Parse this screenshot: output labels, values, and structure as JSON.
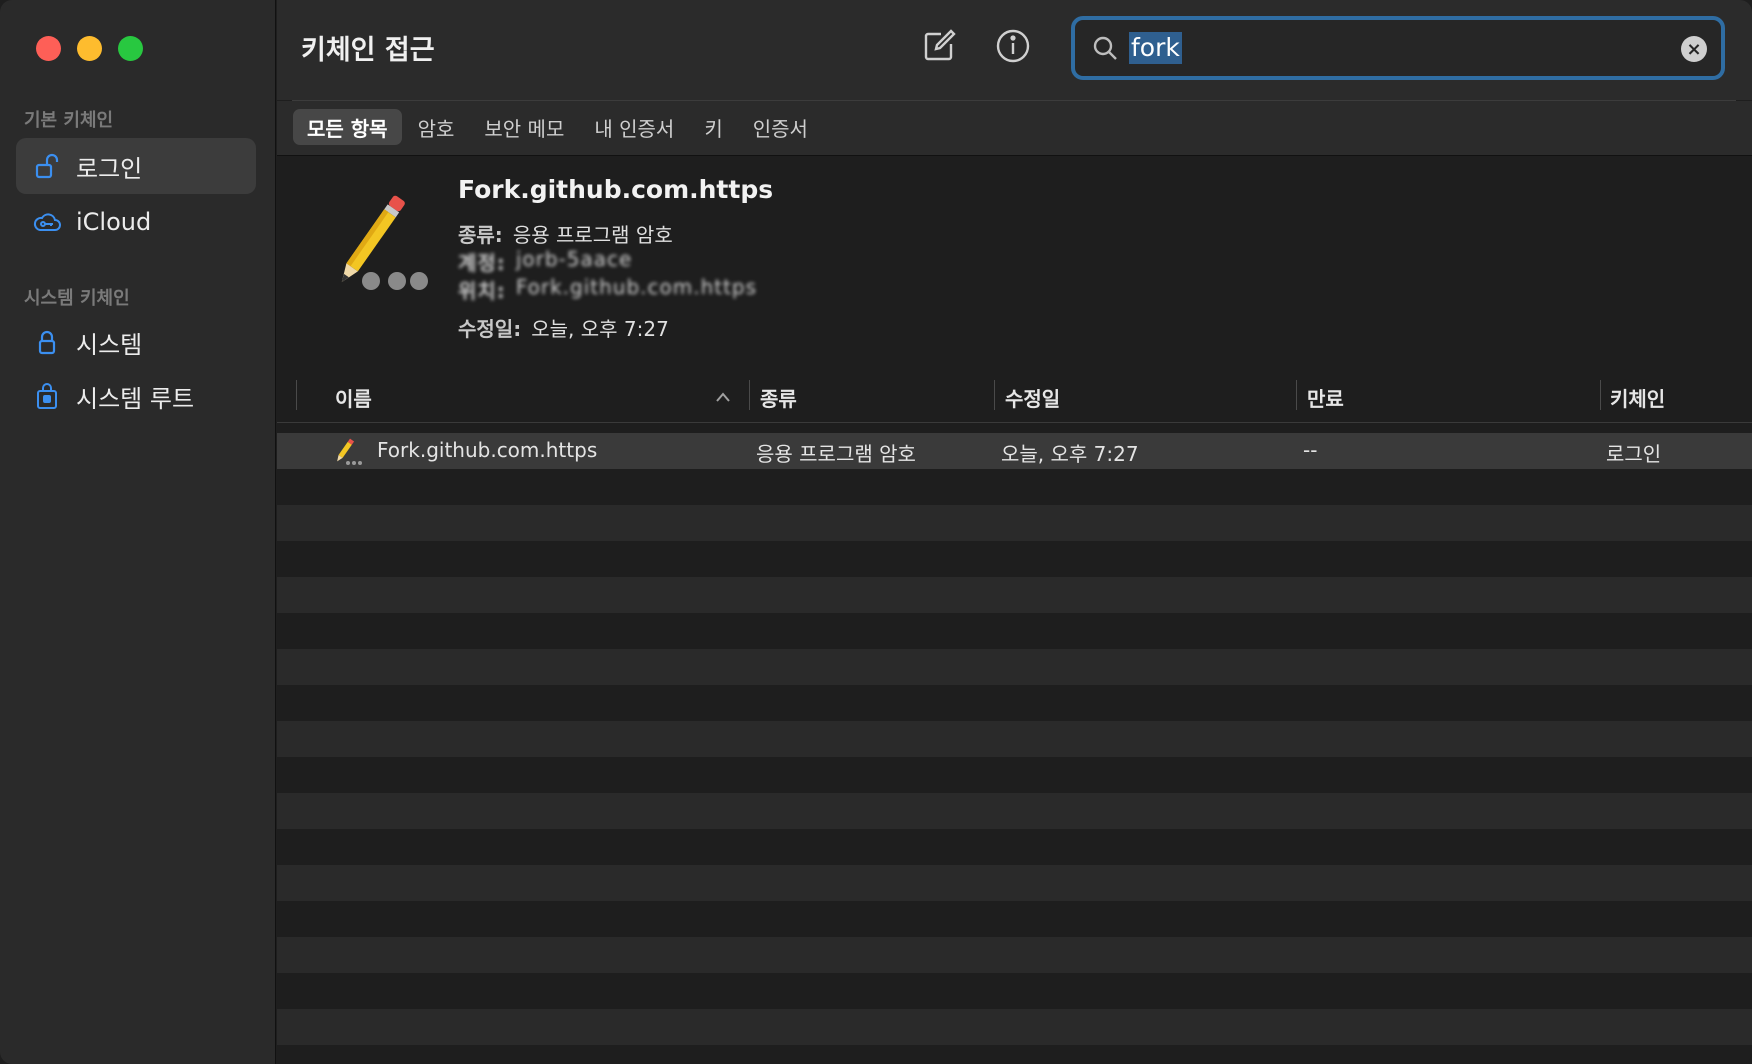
{
  "app": {
    "title": "키체인 접근"
  },
  "sidebar": {
    "section_default": "기본 키체인",
    "section_system": "시스템 키체인",
    "items": [
      {
        "label": "로그인",
        "icon": "unlock-icon",
        "selected": true
      },
      {
        "label": "iCloud",
        "icon": "cloud-key-icon"
      },
      {
        "label": "시스템",
        "icon": "lock-icon"
      },
      {
        "label": "시스템 루트",
        "icon": "locked-cabinet-icon"
      }
    ]
  },
  "search": {
    "query": "fork"
  },
  "filters": [
    "모든 항목",
    "암호",
    "보안 메모",
    "내 인증서",
    "키",
    "인증서"
  ],
  "detail": {
    "name": "Fork.github.com.https",
    "kind_label": "종류:",
    "kind_value": "응용 프로그램 암호",
    "account_label": "계정:",
    "account_value": "jorb-5aace",
    "where_label": "위치:",
    "where_value": "Fork.github.com.https",
    "modified_label": "수정일:",
    "modified_value": "오늘, 오후 7:27"
  },
  "table": {
    "columns": [
      "이름",
      "종류",
      "수정일",
      "만료",
      "키체인"
    ],
    "rows": [
      {
        "name": "Fork.github.com.https",
        "kind": "응용 프로그램 암호",
        "modified": "오늘, 오후 7:27",
        "expires": "--",
        "keychain": "로그인"
      }
    ]
  },
  "colors": {
    "accent": "#2f6da3",
    "sidebar_bg": "#2a2a2a",
    "selected_row": "#3a3a3a"
  }
}
